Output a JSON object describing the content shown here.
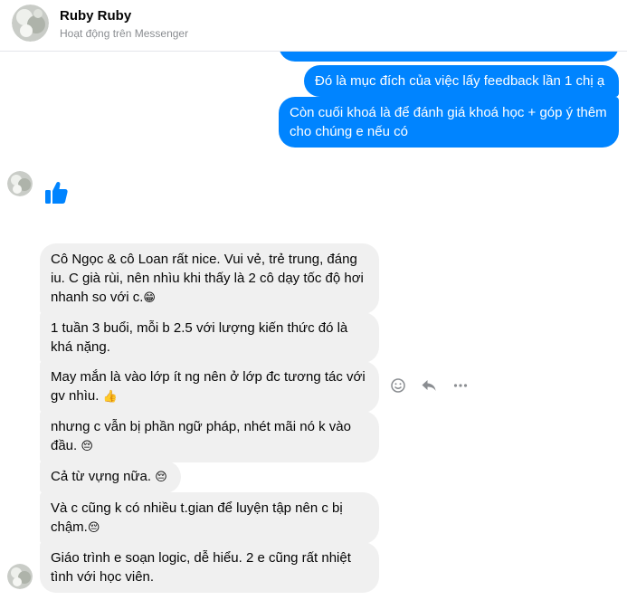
{
  "header": {
    "name": "Ruby Ruby",
    "status": "Hoạt động trên Messenger"
  },
  "outgoing": [
    {
      "text": "Đó là mục đích của việc lấy feedback lần 1 chị ạ"
    },
    {
      "text": "Còn cuối khoá là để đánh giá khoá học + góp ý thêm cho chúng e nếu có"
    }
  ],
  "like_icon": "thumbs-up-icon",
  "incoming": [
    {
      "text": "Cô Ngọc & cô Loan rất nice. Vui vẻ, trẻ trung, đáng iu. C già rùi, nên nhìu khi thấy là 2 cô dạy tốc độ hơi nhanh so với c.",
      "emoji": "😁"
    },
    {
      "text": "1 tuần 3 buổi, mỗi b 2.5 với lượng kiến thức đó là khá nặng.",
      "emoji": ""
    },
    {
      "text": "May mắn là vào lớp ít ng nên ở lớp đc tương tác với gv nhìu. ",
      "emoji": "👍"
    },
    {
      "text": "nhưng c vẫn bị phần ngữ pháp, nhét mãi nó k vào đầu. ",
      "emoji": "😔"
    },
    {
      "text": "Cả từ vựng nữa. ",
      "emoji": "😔"
    },
    {
      "text": "Và c cũng k có nhiều t.gian để luyện tập nên c bị chậm.",
      "emoji": "😔"
    },
    {
      "text": "Giáo trình e soạn logic, dễ hiểu. 2 e cũng rất nhiệt tình với học viên.",
      "emoji": ""
    }
  ],
  "message_actions": [
    "smiley-icon",
    "reply-icon",
    "more-icon"
  ]
}
